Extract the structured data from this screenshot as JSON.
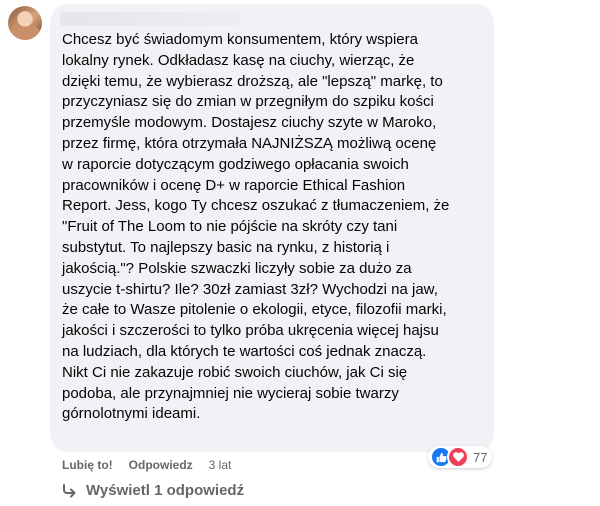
{
  "comment": {
    "text": "Chcesz być świadomym konsumentem, który wspiera\nlokalny rynek. Odkładasz kasę na ciuchy, wierząc, że\ndzięki temu, że wybierasz droższą, ale \"lepszą\" markę, to\nprzyczyniasz się do zmian w przegniłym do szpiku kości\nprzemyśle modowym. Dostajesz ciuchy szyte w Maroko,\nprzez firmę, która otrzymała NAJNIŻSZĄ możliwą ocenę\nw raporcie dotyczącym godziwego opłacania swoich\npracowników i ocenę D+ w raporcie Ethical Fashion\nReport. Jess, kogo Ty chcesz oszukać z tłumaczeniem, że\n\"Fruit of The Loom to nie pójście na skróty czy tani\nsubstytut. To najlepszy basic na rynku, z historią i\njakością.\"? Polskie szwaczki liczyły sobie za dużo za\nuszycie t-shirtu? Ile? 30zł zamiast 3zł? Wychodzi na jaw,\nże całe to Wasze pitolenie o ekologii, etyce, filozofii marki,\njakości i szczerości to tylko próba ukręcenia więcej hajsu\nna ludziach, dla których te wartości coś jednak znaczą.\nNikt Ci nie zakazuje robić swoich ciuchów, jak Ci się\npodoba, ale przynajmniej nie wycieraj sobie twarzy\ngórnolotnymi ideami.",
    "reactions": {
      "icons": [
        "like-icon",
        "love-icon"
      ],
      "count": "77",
      "like_color": "#1877f2",
      "love_color": "#f33e58"
    }
  },
  "actions": {
    "like_label": "Lubię to!",
    "reply_label": "Odpowiedz",
    "timestamp": "3 lat"
  },
  "replies": {
    "label": "Wyświetl 1 odpowiedź"
  }
}
